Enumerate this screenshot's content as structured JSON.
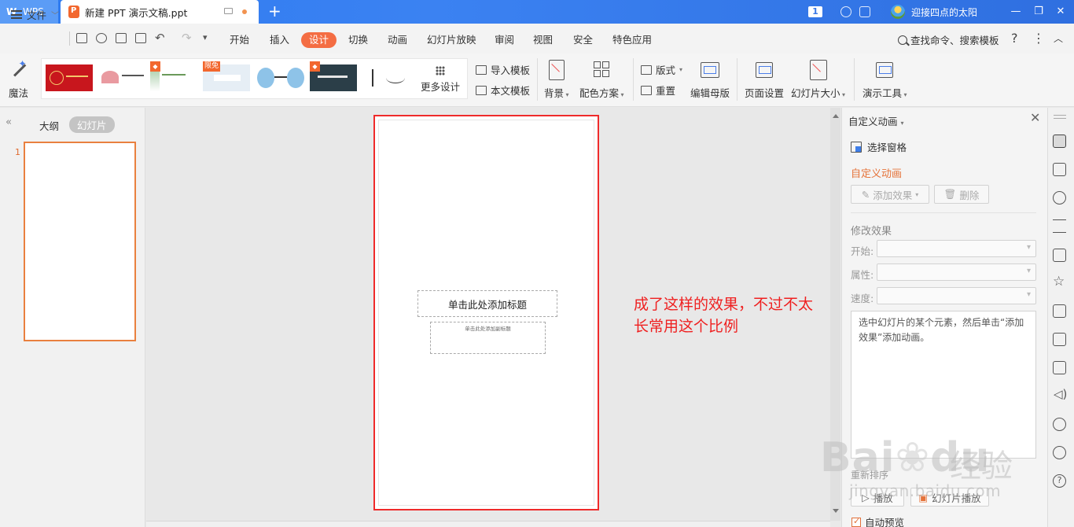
{
  "titlebar": {
    "app_label": "WPS",
    "doc_title": "新建 PPT 演示文稿.ppt",
    "page_badge": "1",
    "user_name": "迎接四点的太阳"
  },
  "menubar": {
    "file_label": "文件",
    "items": [
      "开始",
      "插入",
      "设计",
      "切换",
      "动画",
      "幻灯片放映",
      "审阅",
      "视图",
      "安全",
      "特色应用"
    ],
    "active_item": "设计",
    "search_label": "查找命令、搜索模板",
    "accent_color": "#f46d43"
  },
  "ribbon": {
    "magic_label": "魔法",
    "more_design_label": "更多设计",
    "import_template_label": "导入模板",
    "this_template_label": "本文模板",
    "background_label": "背景",
    "color_scheme_label": "配色方案",
    "layout_label": "版式",
    "reset_label": "重置",
    "edit_master_label": "编辑母版",
    "page_setup_label": "页面设置",
    "slide_size_label": "幻灯片大小",
    "present_tools_label": "演示工具",
    "templates": [
      {
        "caption": "",
        "flag": "",
        "bg": "#c8161d"
      },
      {
        "caption": "",
        "flag": "",
        "bg": "#ffffff"
      },
      {
        "caption": "",
        "flag": "",
        "bg": "#ffffff"
      },
      {
        "caption": "",
        "flag": "限免",
        "bg": "#e6eef5"
      },
      {
        "caption": "",
        "flag": "",
        "bg": "#ffffff"
      },
      {
        "caption": "",
        "flag": "",
        "bg": "#2b3e48"
      },
      {
        "caption": "",
        "flag": "",
        "bg": "#ffffff"
      }
    ]
  },
  "leftpanel": {
    "tab_outline": "大纲",
    "tab_slides": "幻灯片",
    "slide_number": "1"
  },
  "slide": {
    "title_placeholder": "单击此处添加标题",
    "subtitle_placeholder": "单击此处添加副标题"
  },
  "annotation": {
    "note": "成了这样的效果，不过不太长常用这个比例",
    "color": "#ef2020"
  },
  "rightpanel": {
    "header": "自定义动画",
    "select_pane_label": "选择窗格",
    "section_title": "自定义动画",
    "add_effect_label": "添加效果",
    "delete_label": "删除",
    "modify_effect_label": "修改效果",
    "start_label": "开始:",
    "property_label": "属性:",
    "speed_label": "速度:",
    "tip_text": "选中幻灯片的某个元素，然后单击“添加效果”添加动画。",
    "reorder_label": "重新排序",
    "play_label": "播放",
    "slideshow_label": "幻灯片播放",
    "autopreview_label": "自动预览"
  },
  "watermark": {
    "brand": "Bai",
    "brand2": "du",
    "cn": "经验",
    "url": "jingyan.baidu.com"
  }
}
